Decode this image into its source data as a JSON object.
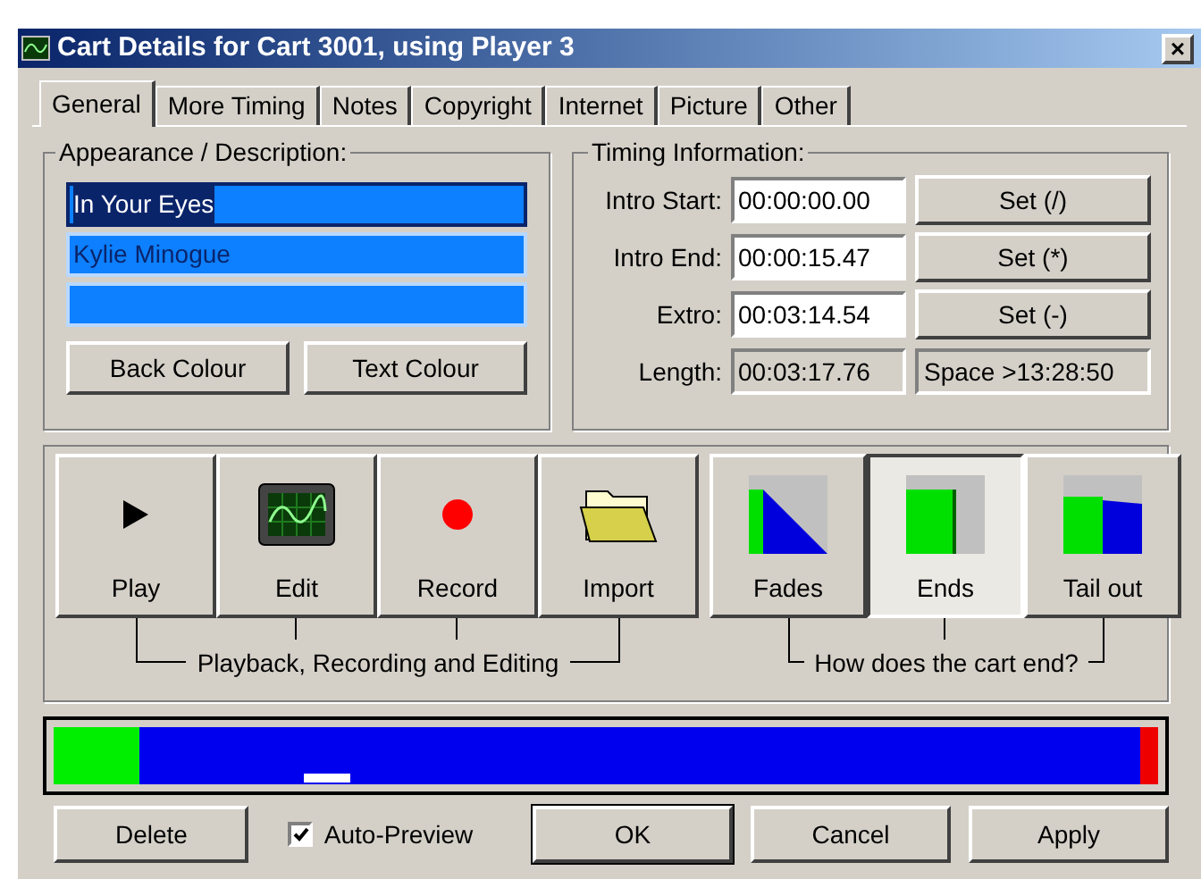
{
  "window": {
    "title": "Cart Details for Cart 3001, using Player 3",
    "close": "×"
  },
  "tabs": [
    {
      "label": "General",
      "selected": true
    },
    {
      "label": "More Timing",
      "selected": false
    },
    {
      "label": "Notes",
      "selected": false
    },
    {
      "label": "Copyright",
      "selected": false
    },
    {
      "label": "Internet",
      "selected": false
    },
    {
      "label": "Picture",
      "selected": false
    },
    {
      "label": "Other",
      "selected": false
    }
  ],
  "appearance": {
    "title": "Appearance / Description:",
    "fields": [
      {
        "value": "In Your Eyes",
        "selected": true
      },
      {
        "value": "Kylie Minogue",
        "selected": false
      },
      {
        "selected": false
      }
    ],
    "buttons": [
      "Back Colour",
      "Text Colour"
    ]
  },
  "timing": {
    "title": "Timing Information:",
    "rows": [
      {
        "label": "Intro Start:",
        "value": "00:00:00.00",
        "editable": true,
        "button": "Set (/)"
      },
      {
        "label": "Intro End:",
        "value": "00:00:15.47",
        "editable": true,
        "button": "Set (*)"
      },
      {
        "label": "Extro:",
        "value": "00:03:14.54",
        "editable": true,
        "button": "Set (-)"
      },
      {
        "label": "Length:",
        "value": "00:03:17.76",
        "editable": false,
        "info": "Space >13:28:50"
      }
    ]
  },
  "actions": {
    "buttons": [
      {
        "kind": "play",
        "label": "Play"
      },
      {
        "kind": "edit",
        "label": "Edit"
      },
      {
        "kind": "record",
        "label": "Record"
      },
      {
        "kind": "import",
        "label": "Import"
      }
    ],
    "caption": "Playback, Recording and Editing"
  },
  "ending": {
    "buttons": [
      {
        "kind": "fades",
        "label": "Fades",
        "selected": false
      },
      {
        "kind": "ends",
        "label": "Ends",
        "selected": true
      },
      {
        "kind": "tailout",
        "label": "Tail out",
        "selected": false
      }
    ],
    "caption": "How does the cart end?"
  },
  "timeline": {
    "segments": [
      {
        "kind": "intro",
        "color": "#00ee00"
      },
      {
        "kind": "body",
        "color": "#0000ee"
      },
      {
        "kind": "extro",
        "color": "#ee0000"
      }
    ],
    "marker": {
      "level": 0.23
    }
  },
  "footer": {
    "delete": "Delete",
    "auto_preview": {
      "label": "Auto-Preview",
      "checked": true
    },
    "buttons": [
      "OK",
      "Cancel",
      "Apply"
    ]
  }
}
